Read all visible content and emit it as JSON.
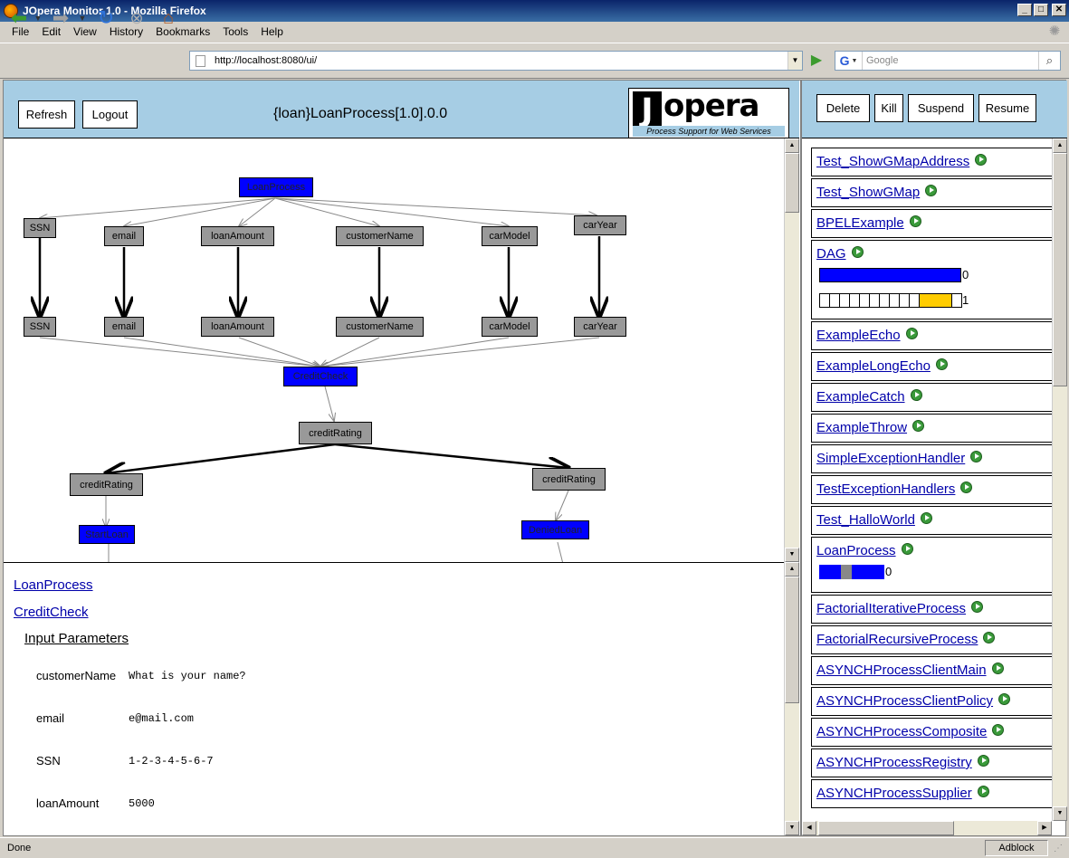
{
  "window": {
    "title": "JOpera Monitor 1.0 - Mozilla Firefox"
  },
  "menu": [
    "File",
    "Edit",
    "View",
    "History",
    "Bookmarks",
    "Tools",
    "Help"
  ],
  "nav": {
    "url": "http://localhost:8080/ui/",
    "search_placeholder": "Google"
  },
  "header": {
    "refresh_label": "Refresh",
    "logout_label": "Logout",
    "process_title": "{loan}LoanProcess[1.0].0.0",
    "logo_letter": "J",
    "logo_word": "opera",
    "logo_tagline": "Process Support for Web Services"
  },
  "actions": {
    "delete": "Delete",
    "kill": "Kill",
    "suspend": "Suspend",
    "resume": "Resume"
  },
  "graph": {
    "nodes": [
      {
        "id": "LoanProcess",
        "label": "LoanProcess",
        "kind": "task"
      },
      {
        "id": "SSN_in",
        "label": "SSN",
        "kind": "data"
      },
      {
        "id": "email_in",
        "label": "email",
        "kind": "data"
      },
      {
        "id": "loanAmount_in",
        "label": "loanAmount",
        "kind": "data"
      },
      {
        "id": "customerName_in",
        "label": "customerName",
        "kind": "data"
      },
      {
        "id": "carModel_in",
        "label": "carModel",
        "kind": "data"
      },
      {
        "id": "carYear_in",
        "label": "carYear",
        "kind": "data"
      },
      {
        "id": "SSN_out",
        "label": "SSN",
        "kind": "data"
      },
      {
        "id": "email_out",
        "label": "email",
        "kind": "data"
      },
      {
        "id": "loanAmount_out",
        "label": "loanAmount",
        "kind": "data"
      },
      {
        "id": "customerName_out",
        "label": "customerName",
        "kind": "data"
      },
      {
        "id": "carModel_out",
        "label": "carModel",
        "kind": "data"
      },
      {
        "id": "carYear_out",
        "label": "carYear",
        "kind": "data"
      },
      {
        "id": "CreditCheck",
        "label": "CreditCheck",
        "kind": "task"
      },
      {
        "id": "creditRating_mid",
        "label": "creditRating",
        "kind": "data"
      },
      {
        "id": "creditRating_left",
        "label": "creditRating",
        "kind": "data"
      },
      {
        "id": "creditRating_right",
        "label": "creditRating",
        "kind": "data"
      },
      {
        "id": "StartLoan",
        "label": "StartLoan",
        "kind": "task"
      },
      {
        "id": "DeniedLoan",
        "label": "DeniedLoan",
        "kind": "task"
      }
    ]
  },
  "details": {
    "crumb_process": "LoanProcess",
    "crumb_task": "CreditCheck",
    "section": "Input Parameters",
    "params": [
      {
        "name": "customerName",
        "value": "What is your name?"
      },
      {
        "name": "email",
        "value": "e@mail.com"
      },
      {
        "name": "SSN",
        "value": "1-2-3-4-5-6-7"
      },
      {
        "name": "loanAmount",
        "value": "5000"
      }
    ]
  },
  "processes": [
    {
      "name": "Test_ShowGMapAddress"
    },
    {
      "name": "Test_ShowGMap"
    },
    {
      "name": "BPELExample"
    },
    {
      "name": "DAG",
      "count1": "0",
      "count2": "1"
    },
    {
      "name": "ExampleEcho"
    },
    {
      "name": "ExampleLongEcho"
    },
    {
      "name": "ExampleCatch"
    },
    {
      "name": "ExampleThrow"
    },
    {
      "name": "SimpleExceptionHandler"
    },
    {
      "name": "TestExceptionHandlers"
    },
    {
      "name": "Test_HalloWorld"
    },
    {
      "name": "LoanProcess",
      "count1": "0"
    },
    {
      "name": "FactorialIterativeProcess"
    },
    {
      "name": "FactorialRecursiveProcess"
    },
    {
      "name": "ASYNCHProcessClientMain"
    },
    {
      "name": "ASYNCHProcessClientPolicy"
    },
    {
      "name": "ASYNCHProcessComposite"
    },
    {
      "name": "ASYNCHProcessRegistry"
    },
    {
      "name": "ASYNCHProcessSupplier"
    }
  ],
  "status": {
    "text": "Done",
    "adblock": "Adblock"
  },
  "colors": {
    "header_bg": "#a6cde4",
    "task_node": "#0000ff",
    "data_node": "#999999",
    "progress_running": "#ffcc00"
  }
}
